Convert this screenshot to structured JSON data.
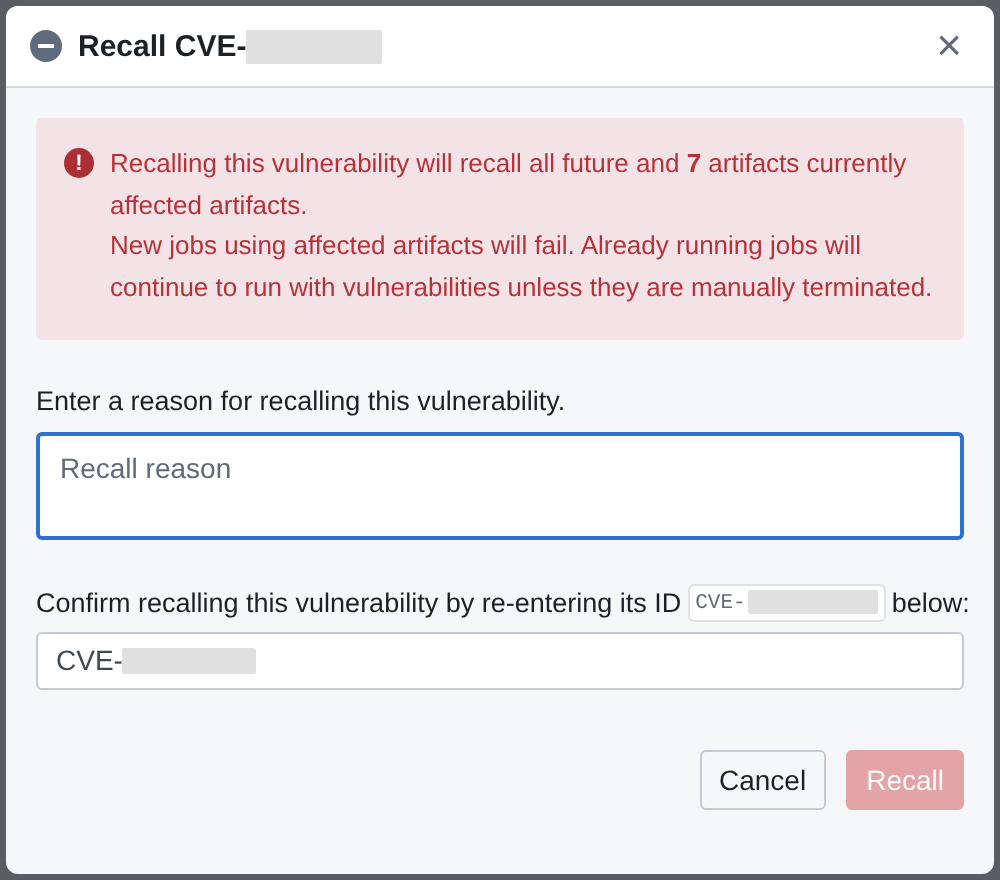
{
  "dialog": {
    "title": "Recall CVE-",
    "title_redacted": true,
    "close": "×"
  },
  "callout": {
    "icon": "!",
    "paragraphs": [
      "Recalling this vulnerability will recall all future and **7** artifacts currently affected artifacts.",
      "New jobs using affected artifacts will fail. Already running jobs will continue to run with vulnerabilities unless they are manually terminated."
    ]
  },
  "reason": {
    "label": "Enter a reason for recalling this vulnerability.",
    "placeholder": "Recall reason",
    "focused": true
  },
  "confirm": {
    "label_before": "Confirm recalling this vulnerability by re-entering its ID",
    "id_code": "CVE-",
    "id_redacted": true,
    "label_after": "below:",
    "value": "CVE-",
    "value_redacted": true
  },
  "buttons": [
    {
      "label": "Cancel",
      "kind": "secondary",
      "disabled": false
    },
    {
      "label": "Recall",
      "kind": "danger",
      "disabled": true
    }
  ]
}
